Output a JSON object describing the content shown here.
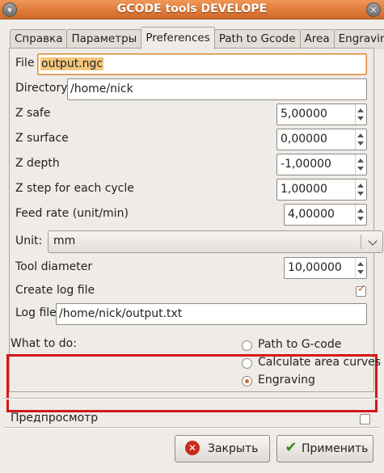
{
  "window": {
    "title": "GCODE tools DEVELOPE"
  },
  "tabs": [
    "Справка",
    "Параметры",
    "Preferences",
    "Path to Gcode",
    "Area",
    "Engraving"
  ],
  "prefs": {
    "file_label": "File",
    "file_value": "output.ngc",
    "directory_label": "Directory",
    "directory_value": "/home/nick",
    "z_safe_label": "Z safe",
    "z_safe_value": "5,00000",
    "z_surface_label": "Z surface",
    "z_surface_value": "0,00000",
    "z_depth_label": "Z depth",
    "z_depth_value": "-1,00000",
    "z_step_label": "Z step for each cycle",
    "z_step_value": "1,00000",
    "feed_label": "Feed rate (unit/min)",
    "feed_value": "4,00000",
    "unit_label": "Unit:",
    "unit_value": "mm",
    "tool_label": "Tool diameter",
    "tool_value": "10,00000",
    "log_create_label": "Create log file",
    "log_create_checked": true,
    "log_file_label": "Log file",
    "log_file_value": "/home/nick/output.txt"
  },
  "what_to_do": {
    "label": "What to do:",
    "options": [
      "Path to G-code",
      "Calculate area curves",
      "Engraving"
    ],
    "selected": 2
  },
  "preview": {
    "label": "Предпросмотр",
    "checked": false
  },
  "buttons": {
    "close": "Закрыть",
    "apply": "Применить"
  },
  "colors": {
    "titlebar": "#e07b3a",
    "highlight": "#d51717",
    "accent": "#d06c2a"
  }
}
